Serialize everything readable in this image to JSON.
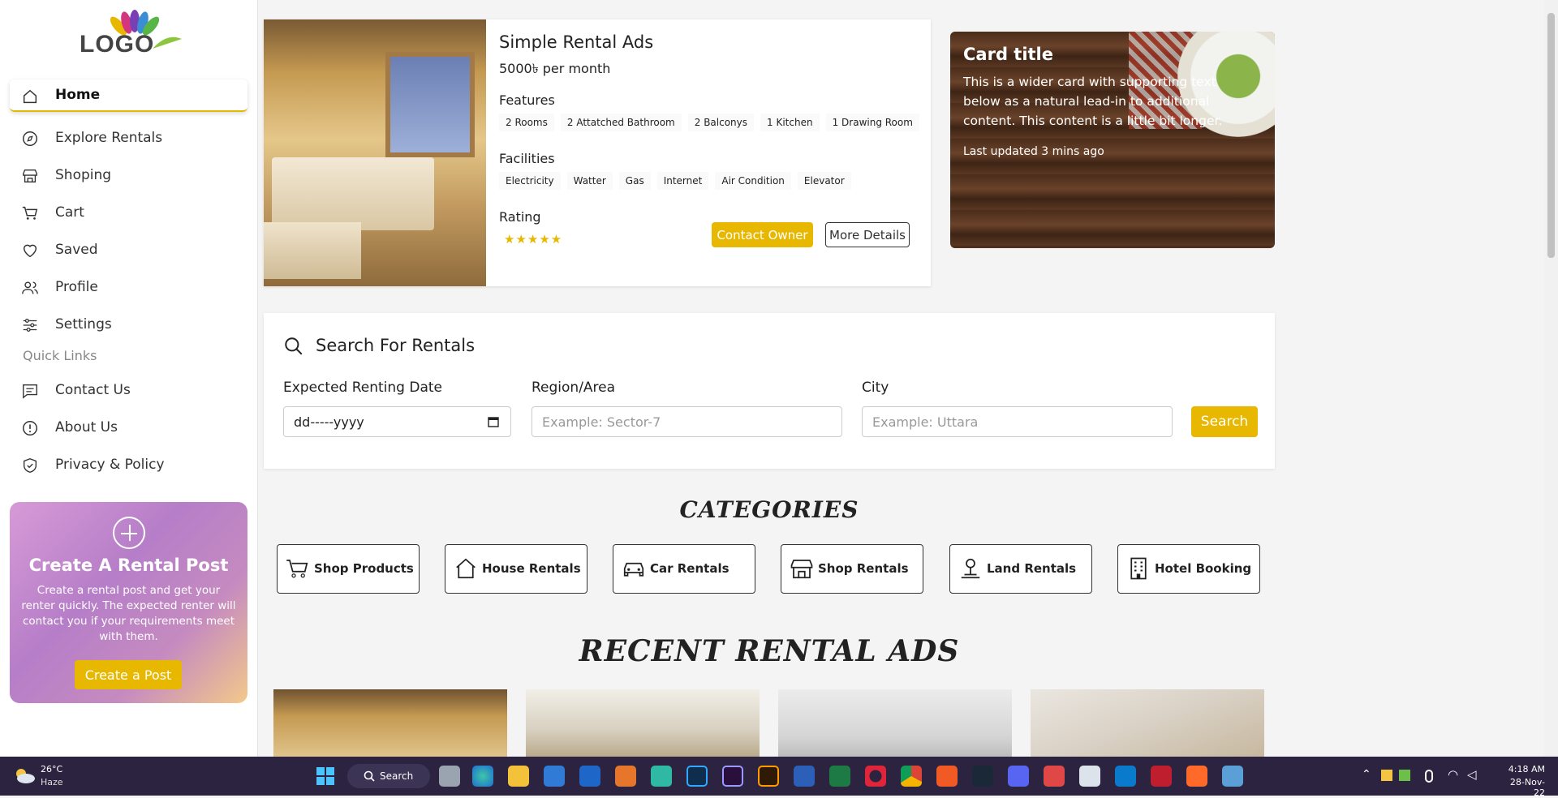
{
  "logo": {
    "text": "LOGO"
  },
  "sidebar": {
    "items": [
      {
        "label": "Home",
        "icon": "home-icon",
        "active": true
      },
      {
        "label": "Explore Rentals",
        "icon": "compass-icon"
      },
      {
        "label": "Shoping",
        "icon": "store-icon"
      },
      {
        "label": "Cart",
        "icon": "cart-icon"
      },
      {
        "label": "Saved",
        "icon": "heart-icon"
      },
      {
        "label": "Profile",
        "icon": "users-icon"
      },
      {
        "label": "Settings",
        "icon": "sliders-icon"
      }
    ],
    "quick_links_label": "Quick Links",
    "quick_links": [
      {
        "label": "Contact Us",
        "icon": "message-icon"
      },
      {
        "label": "About Us",
        "icon": "info-icon"
      },
      {
        "label": "Privacy & Policy",
        "icon": "shield-icon"
      }
    ],
    "promo": {
      "title": "Create A Rental Post",
      "text": "Create a rental post and get your renter quickly. The expected renter will contact you if your requirements meet with them.",
      "button": "Create a Post"
    }
  },
  "rental_card": {
    "title": "Simple Rental Ads",
    "price": "5000৳ per month",
    "features_label": "Features",
    "features": [
      "2 Rooms",
      "2 Attatched Bathroom",
      "2 Balconys",
      "1 Kitchen",
      "1 Drawing Room"
    ],
    "facilities_label": "Facilities",
    "facilities": [
      "Electricity",
      "Watter",
      "Gas",
      "Internet",
      "Air Condition",
      "Elevator"
    ],
    "rating_label": "Rating",
    "rating": 5,
    "stars": "★★★★★",
    "contact_button": "Contact Owner",
    "details_button": "More Details"
  },
  "feature_card": {
    "title": "Card title",
    "text": "This is a wider card with supporting text below as a natural lead-in to additional content. This content is a little bit longer.",
    "updated": "Last updated 3 mins ago"
  },
  "search": {
    "title": "Search For Rentals",
    "date_label": "Expected Renting Date",
    "date_placeholder": "dd-----yyyy",
    "region_label": "Region/Area",
    "region_placeholder": "Example: Sector-7",
    "city_label": "City",
    "city_placeholder": "Example: Uttara",
    "button": "Search"
  },
  "categories": {
    "heading": "CATEGORIES",
    "items": [
      {
        "label": "Shop Products",
        "icon": "cart-icon"
      },
      {
        "label": "House Rentals",
        "icon": "house-icon"
      },
      {
        "label": "Car Rentals",
        "icon": "car-icon"
      },
      {
        "label": "Shop Rentals",
        "icon": "store-icon"
      },
      {
        "label": "Land Rentals",
        "icon": "land-icon"
      },
      {
        "label": "Hotel Booking",
        "icon": "building-icon"
      }
    ]
  },
  "recent": {
    "heading": "RECENT RENTAL ADS"
  },
  "taskbar": {
    "weather_temp": "26°C",
    "weather_desc": "Haze",
    "search_label": "Search",
    "time": "4:18 AM",
    "date": "28-Nov-22"
  },
  "colors": {
    "accent": "#e8b800",
    "taskbar": "#2b2340"
  }
}
